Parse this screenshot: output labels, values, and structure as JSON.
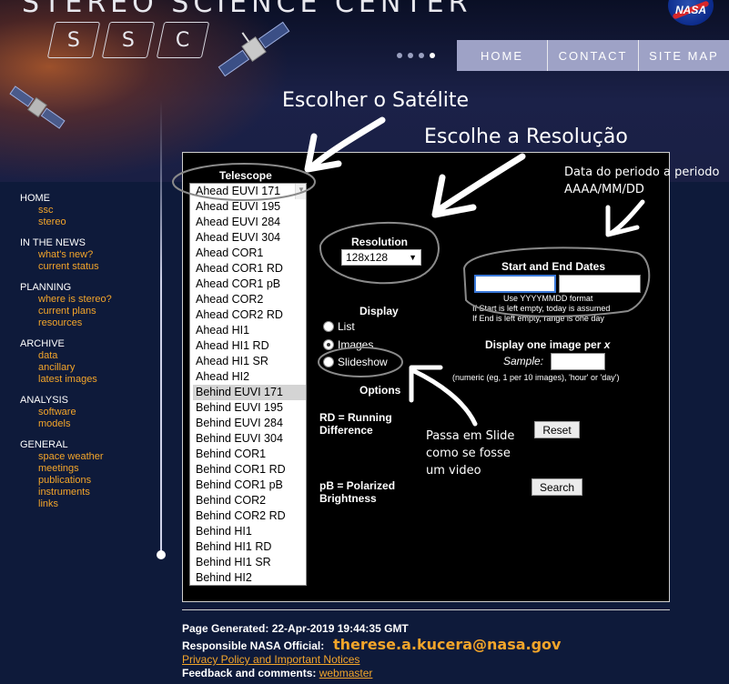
{
  "header": {
    "title": "STEREO SCIENCE CENTER",
    "ssc_letters": [
      "S",
      "S",
      "C"
    ],
    "nasa_logo": "NASA",
    "nav": [
      "HOME",
      "CONTACT",
      "SITE MAP"
    ]
  },
  "sidebar": {
    "groups": [
      {
        "heading": "HOME",
        "links": [
          "ssc",
          "stereo"
        ]
      },
      {
        "heading": "IN THE NEWS",
        "links": [
          "what's new?",
          "current status"
        ]
      },
      {
        "heading": "PLANNING",
        "links": [
          "where is stereo?",
          "current plans",
          "resources"
        ]
      },
      {
        "heading": "ARCHIVE",
        "links": [
          "data",
          "ancillary",
          "latest images"
        ]
      },
      {
        "heading": "ANALYSIS",
        "links": [
          "software",
          "models"
        ]
      },
      {
        "heading": "GENERAL",
        "links": [
          "space weather",
          "meetings",
          "publications",
          "instruments",
          "links"
        ]
      }
    ]
  },
  "form": {
    "telescope_label": "Telescope",
    "telescopes": [
      "Ahead EUVI 171",
      "Ahead EUVI 195",
      "Ahead EUVI 284",
      "Ahead EUVI 304",
      "Ahead COR1",
      "Ahead COR1 RD",
      "Ahead COR1 pB",
      "Ahead COR2",
      "Ahead COR2 RD",
      "Ahead HI1",
      "Ahead HI1 RD",
      "Ahead HI1 SR",
      "Ahead HI2",
      "Behind EUVI 171",
      "Behind EUVI 195",
      "Behind EUVI 284",
      "Behind EUVI 304",
      "Behind COR1",
      "Behind COR1 RD",
      "Behind COR1 pB",
      "Behind COR2",
      "Behind COR2 RD",
      "Behind HI1",
      "Behind HI1 RD",
      "Behind HI1 SR",
      "Behind HI2"
    ],
    "selected_telescope": "Behind EUVI 171",
    "resolution_label": "Resolution",
    "resolution_value": "128x128",
    "display_label": "Display",
    "display_options": [
      "List",
      "Images",
      "Slideshow"
    ],
    "display_selected": "Images",
    "options_label": "Options",
    "rd_text_1": "RD = Running",
    "rd_text_2": "Difference",
    "pb_text_1": "pB = Polarized",
    "pb_text_2": "Brightness",
    "dates_label": "Start and End Dates",
    "date_format": "Use YYYYMMDD format",
    "date_hint_1": "If Start is left empty, today is assumed",
    "date_hint_2": "If End is left empty, range is one day",
    "per_label": "Display one image per",
    "per_var": "x",
    "sample_label": "Sample:",
    "sample_hint": "(numeric (eg, 1 per 10 images), 'hour' or 'day')",
    "reset_button": "Reset",
    "search_button": "Search"
  },
  "annotations": {
    "choose_satellite": "Escolher o Satélite",
    "choose_resolution": "Escolhe a Resolução",
    "date_note_1": "Data do periodo a periodo",
    "date_note_2": "AAAA/MM/DD",
    "slide_note_1": "Passa em Slide",
    "slide_note_2": "como se fosse",
    "slide_note_3": "um video"
  },
  "footer": {
    "generated": "Page Generated: 22-Apr-2019 19:44:35 GMT",
    "official_label": "Responsible NASA Official:",
    "official_email": "therese.a.kucera@nasa.gov",
    "privacy_link": "Privacy Policy and Important Notices",
    "feedback_label": "Feedback and comments:",
    "webmaster_link": "webmaster"
  }
}
